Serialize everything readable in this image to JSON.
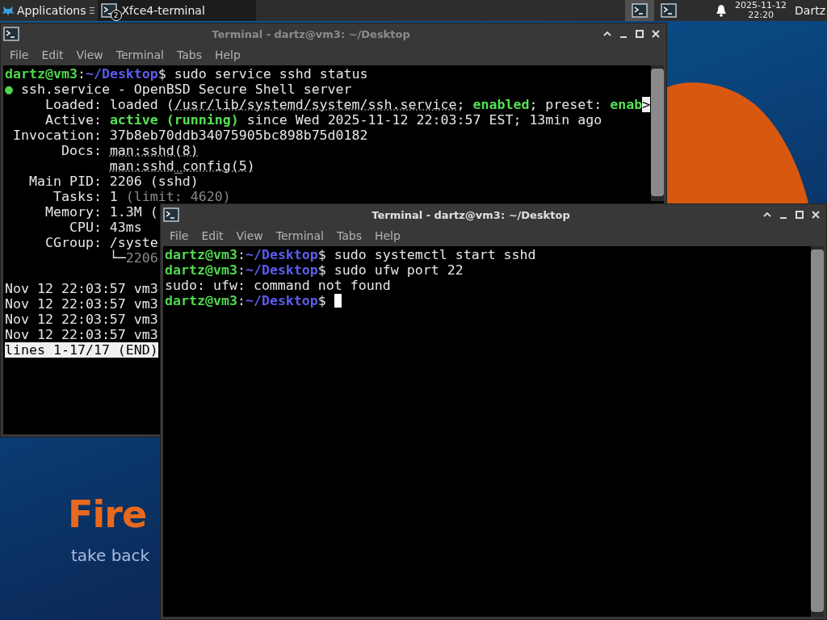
{
  "taskbar": {
    "app_menu": {
      "label": "Applications"
    },
    "tasks": [
      {
        "label": "Xfce4-terminal",
        "badge": "2",
        "selected": true
      }
    ],
    "workspaces": [
      {
        "selected": true
      },
      {
        "selected": false
      }
    ],
    "clock": {
      "date": "2025-11-12",
      "time": "22:20"
    },
    "user": "Dartz"
  },
  "wallpaper": {
    "headline": "Fire",
    "tagline": "take back"
  },
  "windows": [
    {
      "title": "Terminal - dartz@vm3: ~/Desktop",
      "active": false,
      "menu": [
        "File",
        "Edit",
        "View",
        "Terminal",
        "Tabs",
        "Help"
      ],
      "lines": [
        {
          "kind": "text",
          "segments": [
            {
              "text": "dartz@vm3",
              "kind": "user"
            },
            {
              "text": ":",
              "kind": "plain"
            },
            {
              "text": "~/Desktop",
              "kind": "path"
            },
            {
              "text": "$ sudo service sshd status",
              "kind": "plain"
            }
          ]
        },
        {
          "kind": "text",
          "segments": [
            {
              "text": "●",
              "kind": "green"
            },
            {
              "text": " ssh.service - OpenBSD Secure Shell server",
              "kind": "plain"
            }
          ]
        },
        {
          "kind": "text",
          "segments": [
            {
              "text": "     Loaded: loaded (",
              "kind": "plain"
            },
            {
              "text": "/usr/lib/systemd/system/ssh.service",
              "kind": "link"
            },
            {
              "text": "; ",
              "kind": "plain"
            },
            {
              "text": "enabled",
              "kind": "strong"
            },
            {
              "text": "; preset: ",
              "kind": "plain"
            },
            {
              "text": "enab",
              "kind": "strong"
            },
            {
              "text": ">",
              "kind": "reverse"
            }
          ]
        },
        {
          "kind": "text",
          "segments": [
            {
              "text": "     Active: ",
              "kind": "plain"
            },
            {
              "text": "active (running)",
              "kind": "strong"
            },
            {
              "text": " since Wed 2025-11-12 22:03:57 EST; 13min ago",
              "kind": "plain"
            }
          ]
        },
        {
          "kind": "text",
          "segments": [
            {
              "text": " Invocation: 37b8eb70ddb34075905bc898b75d0182",
              "kind": "plain"
            }
          ]
        },
        {
          "kind": "text",
          "segments": [
            {
              "text": "       Docs: ",
              "kind": "plain"
            },
            {
              "text": "man:sshd(8)",
              "kind": "link"
            }
          ]
        },
        {
          "kind": "indented",
          "segments": [
            {
              "text": "man:sshd_config(5)",
              "kind": "link"
            }
          ]
        },
        {
          "kind": "text",
          "segments": [
            {
              "text": "   Main PID: 2206 (sshd)",
              "kind": "plain"
            }
          ]
        },
        {
          "kind": "text",
          "segments": [
            {
              "text": "      Tasks: 1 ",
              "kind": "plain"
            },
            {
              "text": "(limit: 4620)",
              "kind": "dim"
            }
          ]
        },
        {
          "kind": "text",
          "segments": [
            {
              "text": "     Memory: 1.3M (",
              "kind": "plain"
            }
          ]
        },
        {
          "kind": "text",
          "segments": [
            {
              "text": "        CPU: 43ms",
              "kind": "plain"
            }
          ]
        },
        {
          "kind": "text",
          "segments": [
            {
              "text": "     CGroup: /syste",
              "kind": "plain"
            }
          ]
        },
        {
          "kind": "indented",
          "segments": [
            {
              "text": "└─",
              "kind": "plain"
            },
            {
              "text": "2206",
              "kind": "dim"
            }
          ]
        },
        {
          "kind": "blank"
        },
        {
          "kind": "text",
          "segments": [
            {
              "text": "Nov 12 22:03:57 vm3",
              "kind": "plain"
            }
          ]
        },
        {
          "kind": "text",
          "segments": [
            {
              "text": "Nov 12 22:03:57 vm3",
              "kind": "plain"
            }
          ]
        },
        {
          "kind": "text",
          "segments": [
            {
              "text": "Nov 12 22:03:57 vm3",
              "kind": "plain"
            }
          ]
        },
        {
          "kind": "text",
          "segments": [
            {
              "text": "Nov 12 22:03:57 vm3",
              "kind": "plain"
            }
          ]
        },
        {
          "kind": "text",
          "segments": [
            {
              "text": "lines 1-17/17 (END)",
              "kind": "reverse"
            }
          ]
        }
      ]
    },
    {
      "title": "Terminal - dartz@vm3: ~/Desktop",
      "active": true,
      "menu": [
        "File",
        "Edit",
        "View",
        "Terminal",
        "Tabs",
        "Help"
      ],
      "cursor": true,
      "lines": [
        {
          "kind": "text",
          "segments": [
            {
              "text": "dartz@vm3",
              "kind": "user"
            },
            {
              "text": ":",
              "kind": "plain"
            },
            {
              "text": "~/Desktop",
              "kind": "path"
            },
            {
              "text": "$ sudo systemctl start sshd",
              "kind": "plain"
            }
          ]
        },
        {
          "kind": "text",
          "segments": [
            {
              "text": "dartz@vm3",
              "kind": "user"
            },
            {
              "text": ":",
              "kind": "plain"
            },
            {
              "text": "~/Desktop",
              "kind": "path"
            },
            {
              "text": "$ sudo ufw port 22",
              "kind": "plain"
            }
          ]
        },
        {
          "kind": "text",
          "segments": [
            {
              "text": "sudo: ufw: command not found",
              "kind": "plain"
            }
          ]
        },
        {
          "kind": "text",
          "segments": [
            {
              "text": "dartz@vm3",
              "kind": "user"
            },
            {
              "text": ":",
              "kind": "plain"
            },
            {
              "text": "~/Desktop",
              "kind": "path"
            },
            {
              "text": "$",
              "kind": "plain"
            }
          ]
        }
      ]
    }
  ]
}
